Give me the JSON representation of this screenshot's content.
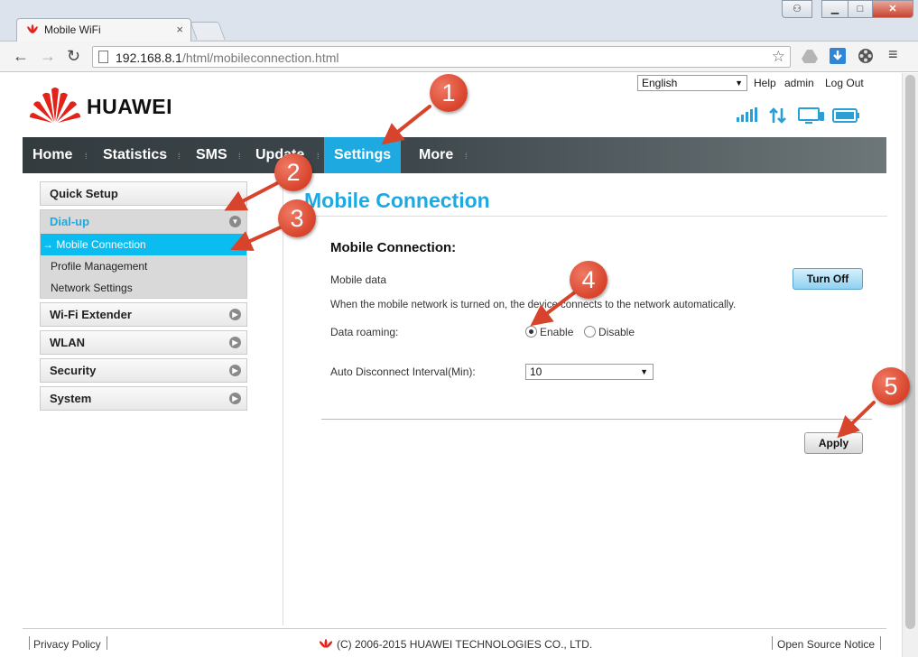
{
  "browser": {
    "tab_title": "Mobile WiFi",
    "tab_close": "×",
    "url_host": "192.168.8.1",
    "url_path": "/html/mobileconnection.html",
    "win_minimize": "▁",
    "win_maximize": "□",
    "win_close": "✕"
  },
  "header": {
    "brand": "HUAWEI",
    "language": "English",
    "links": {
      "help": "Help",
      "user": "admin",
      "logout": "Log Out"
    }
  },
  "mainnav": {
    "items": [
      {
        "label": "Home"
      },
      {
        "label": "Statistics"
      },
      {
        "label": "SMS"
      },
      {
        "label": "Update"
      },
      {
        "label": "Settings"
      },
      {
        "label": "More"
      }
    ],
    "active": "Settings"
  },
  "sidebar": {
    "quick_setup": "Quick Setup",
    "dialup": {
      "title": "Dial-up",
      "items": [
        {
          "label": "→ Mobile Connection"
        },
        {
          "label": "Profile Management"
        },
        {
          "label": "Network Settings"
        }
      ]
    },
    "wifi_extender": "Wi-Fi Extender",
    "wlan": "WLAN",
    "security": "Security",
    "system": "System"
  },
  "content": {
    "title": "Mobile Connection",
    "section_title": "Mobile Connection:",
    "mobile_data_label": "Mobile data",
    "turn_off_button": "Turn Off",
    "info_text": "When the mobile network is turned on, the device connects to the network automatically.",
    "roaming_label": "Data roaming:",
    "roaming_enable": "Enable",
    "roaming_disable": "Disable",
    "roaming_selected": "Enable",
    "interval_label": "Auto Disconnect Interval(Min):",
    "interval_value": "10",
    "apply_button": "Apply"
  },
  "footer": {
    "privacy": "Privacy Policy",
    "copyright": "(C) 2006-2015 HUAWEI TECHNOLOGIES CO., LTD.",
    "open_source": "Open Source Notice"
  },
  "annotations": [
    "1",
    "2",
    "3",
    "4",
    "5"
  ],
  "colors": {
    "accent": "#1ea9e1",
    "callout": "#d8432b",
    "nav_bg": "#3e484c",
    "brand_red": "#e2231a"
  }
}
